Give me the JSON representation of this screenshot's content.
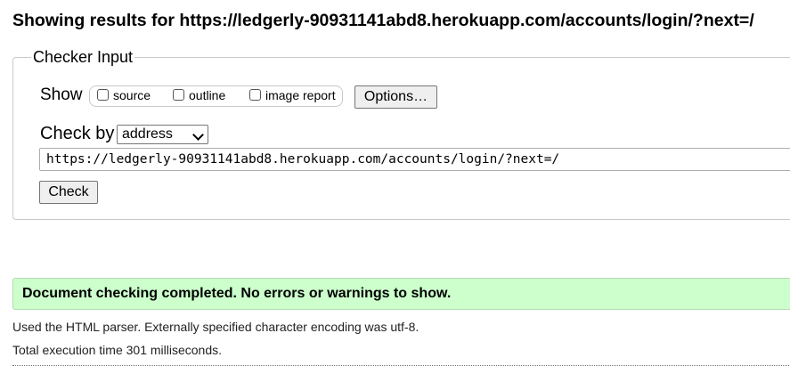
{
  "heading": "Showing results for https://ledgerly-90931141abd8.herokuapp.com/accounts/login/?next=/",
  "checker": {
    "legend": "Checker Input",
    "show_label": "Show",
    "show_options": [
      {
        "label": "source",
        "checked": false
      },
      {
        "label": "outline",
        "checked": false
      },
      {
        "label": "image report",
        "checked": false
      }
    ],
    "options_button": "Options…",
    "check_by_label": "Check by",
    "check_by_value": "address",
    "address_value": "https://ledgerly-90931141abd8.herokuapp.com/accounts/login/?next=/",
    "check_button": "Check"
  },
  "result": {
    "status_message": "Document checking completed. No errors or warnings to show.",
    "parser_info": "Used the HTML parser. Externally specified character encoding was utf-8.",
    "execution_time": "Total execution time 301 milliseconds."
  },
  "colors": {
    "success_background": "#ccffcc",
    "button_background": "#efefef"
  }
}
